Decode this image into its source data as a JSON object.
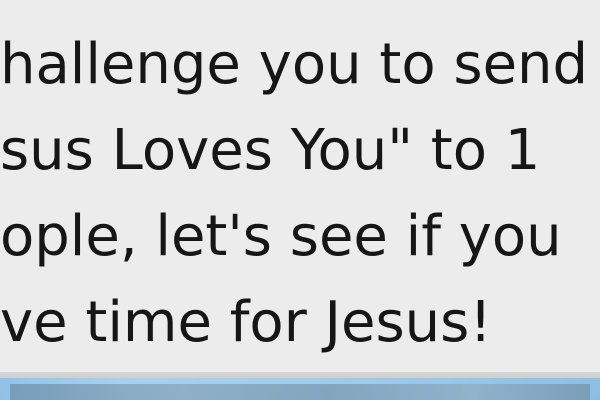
{
  "message": {
    "lines": [
      "hallenge you to send",
      "sus Loves You\" to 1",
      "ople, let's see if you",
      "ve time for Jesus!"
    ]
  },
  "colors": {
    "background": "#ececec",
    "text": "#161616",
    "next_bubble": "#9dc9ea"
  }
}
